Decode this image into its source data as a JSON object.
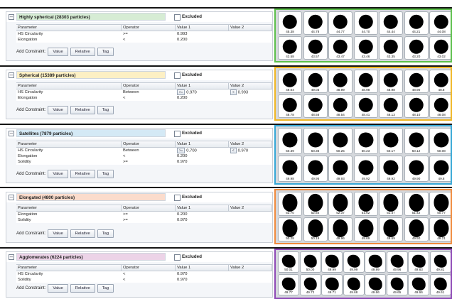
{
  "common": {
    "excluded_label": "Excluded",
    "columns": [
      "Parameter",
      "Operator",
      "Value 1",
      "Value 2"
    ],
    "add_constraint_label": "Add Constraint:",
    "add_buttons": [
      "Value",
      "Relative",
      "Tag"
    ]
  },
  "groups": [
    {
      "title": "Highly spherical (28303 particles)",
      "color": "#d6ecd4",
      "border_color": "#5cbf4b",
      "constraints": [
        {
          "parameter": "HS Circularity",
          "operator": ">=",
          "value1": "0.993",
          "value2": ""
        },
        {
          "parameter": "Elongation",
          "operator": "<",
          "value1": "0.200",
          "value2": ""
        }
      ],
      "values": [
        [
          "45.38",
          "44.78",
          "44.77",
          "44.70",
          "44.44",
          "44.21",
          "44.08"
        ],
        [
          "43.58",
          "43.57",
          "43.47",
          "43.46",
          "43.35",
          "43.20",
          "43.02"
        ]
      ]
    },
    {
      "title": "Spherical (15389 particles)",
      "color": "#fdf0c4",
      "border_color": "#f0b623",
      "constraints": [
        {
          "parameter": "HS Circularity",
          "operator": "Between",
          "value1": "0.970",
          "value2": "0.993",
          "op1": ">=",
          "op2": "<"
        },
        {
          "parameter": "Elongation",
          "operator": "<",
          "value1": "0.200",
          "value2": ""
        }
      ],
      "values": [
        [
          "49.04",
          "49.03",
          "48.99",
          "48.98",
          "48.98",
          "48.90",
          "48.8"
        ],
        [
          "48.78",
          "48.56",
          "48.54",
          "48.41",
          "48.13",
          "48.10",
          "48.08"
        ]
      ]
    },
    {
      "title": "Satellites (7879 particles)",
      "color": "#d4e9f5",
      "border_color": "#35a7d6",
      "constraints": [
        {
          "parameter": "HS Circularity",
          "operator": "Between",
          "value1": "0.700",
          "value2": "0.970",
          "op1": ">=",
          "op2": "<"
        },
        {
          "parameter": "Elongation",
          "operator": "<",
          "value1": "0.200",
          "value2": ""
        },
        {
          "parameter": "Solidity",
          "operator": ">=",
          "value1": "0.970",
          "value2": ""
        }
      ],
      "values": [
        [
          "50.39",
          "50.36",
          "50.25",
          "50.23",
          "50.17",
          "50.12",
          "50.08"
        ],
        [
          "49.98",
          "49.95",
          "49.93",
          "49.92",
          "49.92",
          "49.90",
          "49.8"
        ]
      ]
    },
    {
      "title": "Elongated (4800 particles)",
      "color": "#fbdccc",
      "border_color": "#f08a3c",
      "constraints": [
        {
          "parameter": "Elongation",
          "operator": ">=",
          "value1": "0.200",
          "value2": ""
        },
        {
          "parameter": "Solidity",
          "operator": ">=",
          "value1": "0.970",
          "value2": ""
        }
      ],
      "values": [
        [
          "52.70",
          "52.54",
          "52.37",
          "51.62",
          "51.47",
          "51.42",
          "50.77"
        ],
        [
          "50.28",
          "50.19",
          "49.96",
          "49.69",
          "49.69",
          "49.50",
          "49.21"
        ]
      ]
    },
    {
      "title": "Agglomerates (6224 particles)",
      "color": "#ecd3e7",
      "border_color": "#8e49b6",
      "constraints": [
        {
          "parameter": "HS Circularity",
          "operator": "<",
          "value1": "0.970",
          "value2": ""
        },
        {
          "parameter": "Solidity",
          "operator": "<",
          "value1": "0.970",
          "value2": ""
        }
      ],
      "values": [
        [
          "50.01",
          "50.00",
          "49.99",
          "49.99",
          "49.99",
          "49.96",
          "49.83",
          "49.81"
        ],
        [
          "49.77",
          "49.72",
          "49.71",
          "49.68",
          "49.66",
          "49.65",
          "49.66",
          "49.61"
        ]
      ]
    }
  ]
}
